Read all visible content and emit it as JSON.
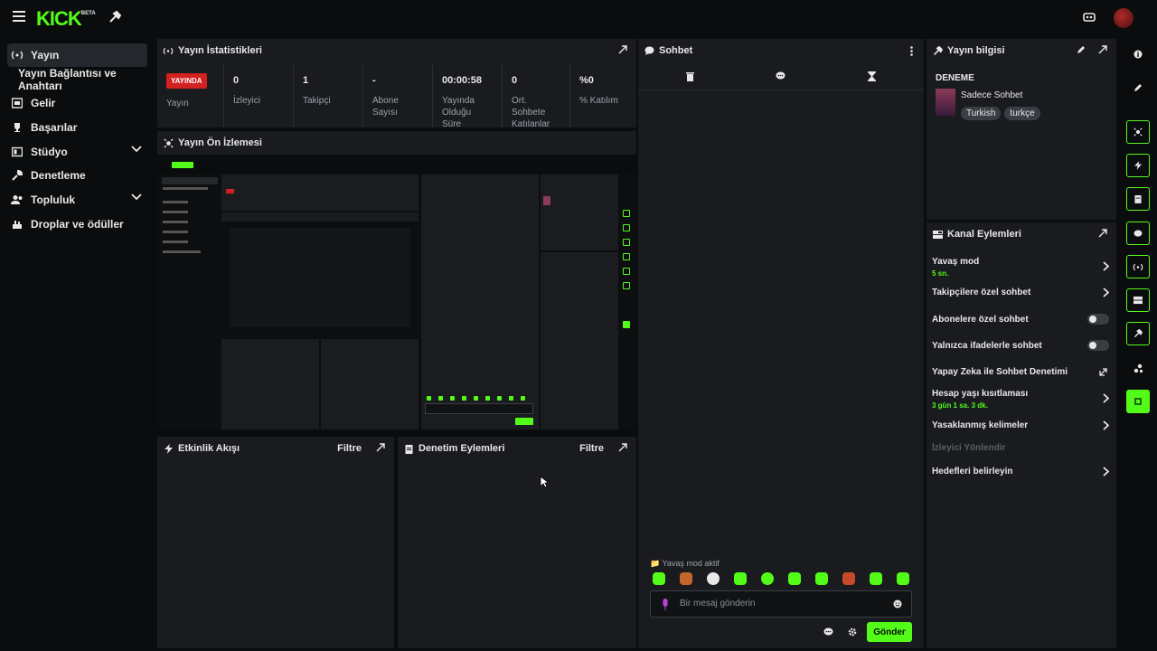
{
  "app": {
    "logo": "KICK",
    "logo_badge": "BETA"
  },
  "sidebar": {
    "items": [
      {
        "label": "Yayın",
        "icon": "broadcast-icon"
      },
      {
        "label": "Yayın Bağlantısı ve Anahtarı",
        "icon": ""
      },
      {
        "label": "Gelir",
        "icon": "revenue-icon"
      },
      {
        "label": "Başarılar",
        "icon": "trophy-icon"
      },
      {
        "label": "Stüdyo",
        "icon": "studio-icon"
      },
      {
        "label": "Denetleme",
        "icon": "wrench-icon"
      },
      {
        "label": "Topluluk",
        "icon": "community-icon"
      },
      {
        "label": "Droplar ve ödüller",
        "icon": "drops-icon"
      }
    ]
  },
  "stats": {
    "title": "Yayın İstatistikleri",
    "badge": "YAYINDA",
    "items": [
      {
        "value": "",
        "label": "Yayın"
      },
      {
        "value": "0",
        "label": "İzleyici"
      },
      {
        "value": "1",
        "label": "Takipçi"
      },
      {
        "value": "-",
        "label": "Abone Sayısı"
      },
      {
        "value": "00:00:58",
        "label": "Yayında Olduğu Süre"
      },
      {
        "value": "0",
        "label": "Ort. Sohbete Katılanlar"
      },
      {
        "value": "%0",
        "label": "% Katılım"
      }
    ]
  },
  "preview": {
    "title": "Yayın Ön İzlemesi"
  },
  "activity": {
    "title": "Etkinlik Akışı",
    "filter": "Filtre"
  },
  "moderation": {
    "title": "Denetim Eylemleri",
    "filter": "Filtre"
  },
  "chat": {
    "title": "Sohbet",
    "slow_mode": "Yavaş mod aktif",
    "placeholder": "Bir mesaj gönderin",
    "send": "Gönder"
  },
  "info": {
    "title": "Yayın bilgisi",
    "stream_title": "DENEME",
    "category": "Sadece Sohbet",
    "tags": [
      "Turkish",
      "turkçe"
    ]
  },
  "actions": {
    "title": "Kanal Eylemleri",
    "rows": [
      {
        "label": "Yavaş mod",
        "sub": "5 sn.",
        "control": "arrow"
      },
      {
        "label": "Takipçilere özel sohbet",
        "sub": "",
        "control": "arrow"
      },
      {
        "label": "Abonelere özel sohbet",
        "sub": "",
        "control": "toggle"
      },
      {
        "label": "Yalnızca ifadelerle sohbet",
        "sub": "",
        "control": "toggle"
      },
      {
        "label": "Yapay Zeka ile Sohbet Denetimi",
        "sub": "",
        "control": "external"
      },
      {
        "label": "Hesap yaşı kısıtlaması",
        "sub": "3 gün 1 sa. 3 dk.",
        "control": "arrow"
      },
      {
        "label": "Yasaklanmış kelimeler",
        "sub": "",
        "control": "arrow"
      },
      {
        "label": "İzleyici Yönlendir",
        "sub": "",
        "control": "none"
      },
      {
        "label": "Hedefleri belirleyin",
        "sub": "",
        "control": "arrow"
      }
    ]
  },
  "colors": {
    "accent": "#53fc18",
    "live": "#d32020",
    "panel": "#191b1f",
    "bg": "#0b0c0d"
  }
}
